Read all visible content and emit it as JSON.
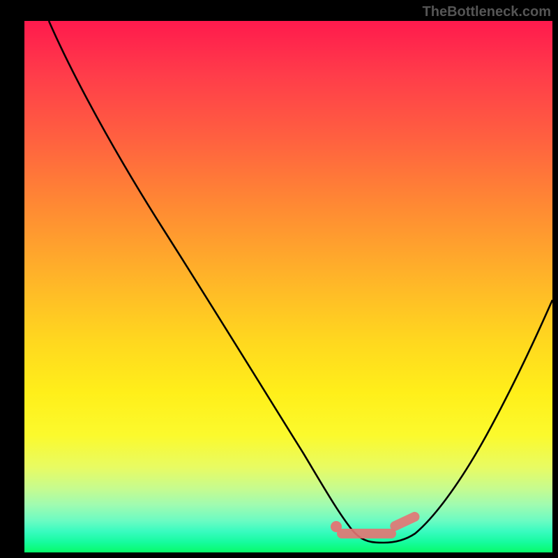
{
  "watermark": "TheBottleneck.com",
  "chart_data": {
    "type": "line",
    "title": "",
    "xlabel": "",
    "ylabel": "",
    "xlim": [
      0,
      100
    ],
    "ylim": [
      0,
      100
    ],
    "x": [
      4.6,
      10,
      20,
      30,
      40,
      50,
      55,
      58,
      60,
      62,
      65,
      70,
      72,
      75,
      80,
      85,
      90,
      95,
      100
    ],
    "values": [
      100,
      87,
      72,
      57,
      42,
      27,
      19,
      13,
      9,
      5.5,
      3,
      2,
      2.5,
      4,
      10,
      20,
      32,
      45,
      58
    ],
    "marker_segment": {
      "x_start": 59,
      "x_end": 74,
      "y": 3
    },
    "marker_dot": {
      "x": 59,
      "y": 4
    },
    "background_gradient": {
      "top_color": "#ff1a4d",
      "bottom_color": "#08fb6a"
    }
  }
}
